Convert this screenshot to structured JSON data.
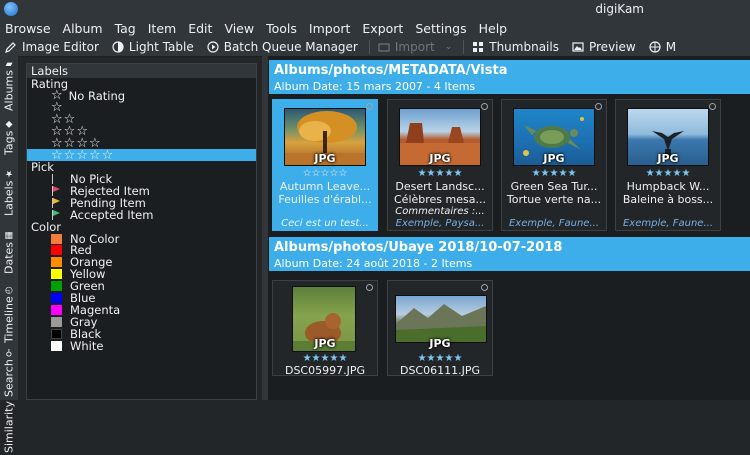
{
  "window": {
    "title": "digiKam"
  },
  "menu": [
    "Browse",
    "Album",
    "Tag",
    "Item",
    "Edit",
    "View",
    "Tools",
    "Import",
    "Export",
    "Settings",
    "Help"
  ],
  "toolbar": {
    "image_editor": "Image Editor",
    "light_table": "Light Table",
    "batch_queue": "Batch Queue Manager",
    "import": "Import",
    "thumbnails": "Thumbnails",
    "preview": "Preview",
    "map_truncated": "M"
  },
  "sidebar_tabs": [
    "Albums",
    "Tags",
    "Labels",
    "Dates",
    "Timeline",
    "Search",
    "Similarity"
  ],
  "labels_panel": {
    "title": "Labels",
    "rating_group": "Rating",
    "no_rating": "No Rating",
    "pick_group": "Pick",
    "picks": [
      {
        "label": "No Pick",
        "color": "#1b1e20"
      },
      {
        "label": "Rejected Item",
        "color": "#e8436b"
      },
      {
        "label": "Pending Item",
        "color": "#f0b43a"
      },
      {
        "label": "Accepted Item",
        "color": "#43c074"
      }
    ],
    "color_group": "Color",
    "colors": [
      {
        "label": "No Color",
        "color": "#f47c3c"
      },
      {
        "label": "Red",
        "color": "#ff0000"
      },
      {
        "label": "Orange",
        "color": "#ff8c00"
      },
      {
        "label": "Yellow",
        "color": "#ffff00"
      },
      {
        "label": "Green",
        "color": "#00a000"
      },
      {
        "label": "Blue",
        "color": "#0000ff"
      },
      {
        "label": "Magenta",
        "color": "#ff00ff"
      },
      {
        "label": "Gray",
        "color": "#9a9a9a"
      },
      {
        "label": "Black",
        "color": "#000000"
      },
      {
        "label": "White",
        "color": "#ffffff"
      }
    ]
  },
  "albums": [
    {
      "title": "Albums/photos/METADATA/Vista",
      "subtitle": "Album Date: 15 mars 2007 - 4 Items",
      "items": [
        {
          "type": "JPG",
          "name": "Autumn Leave...",
          "title": "Feuilles d'érabl...",
          "comment": "",
          "caption": "Ceci est un test...",
          "selected": true
        },
        {
          "type": "JPG",
          "name": "Desert Landsc...",
          "title": "Célèbres mesa...",
          "comment": "Commentaires :...",
          "caption": "Exemple, Paysa...",
          "selected": false
        },
        {
          "type": "JPG",
          "name": "Green Sea Tur...",
          "title": "Tortue verte na...",
          "comment": "",
          "caption": "Exemple, Faune...",
          "selected": false
        },
        {
          "type": "JPG",
          "name": "Humpback W...",
          "title": "Baleine à boss...",
          "comment": "",
          "caption": "Exemple, Faune...",
          "selected": false
        }
      ]
    },
    {
      "title": "Albums/photos/Ubaye 2018/10-07-2018",
      "subtitle": "Album Date: 24 août 2018 - 2 Items",
      "items": [
        {
          "type": "JPG",
          "name": "DSC05997.JPG"
        },
        {
          "type": "JPG",
          "name": "DSC06111.JPG"
        }
      ]
    }
  ],
  "colors": {
    "accent": "#3daee9",
    "window_bg": "#232629",
    "view_bg": "#1b1e20"
  }
}
